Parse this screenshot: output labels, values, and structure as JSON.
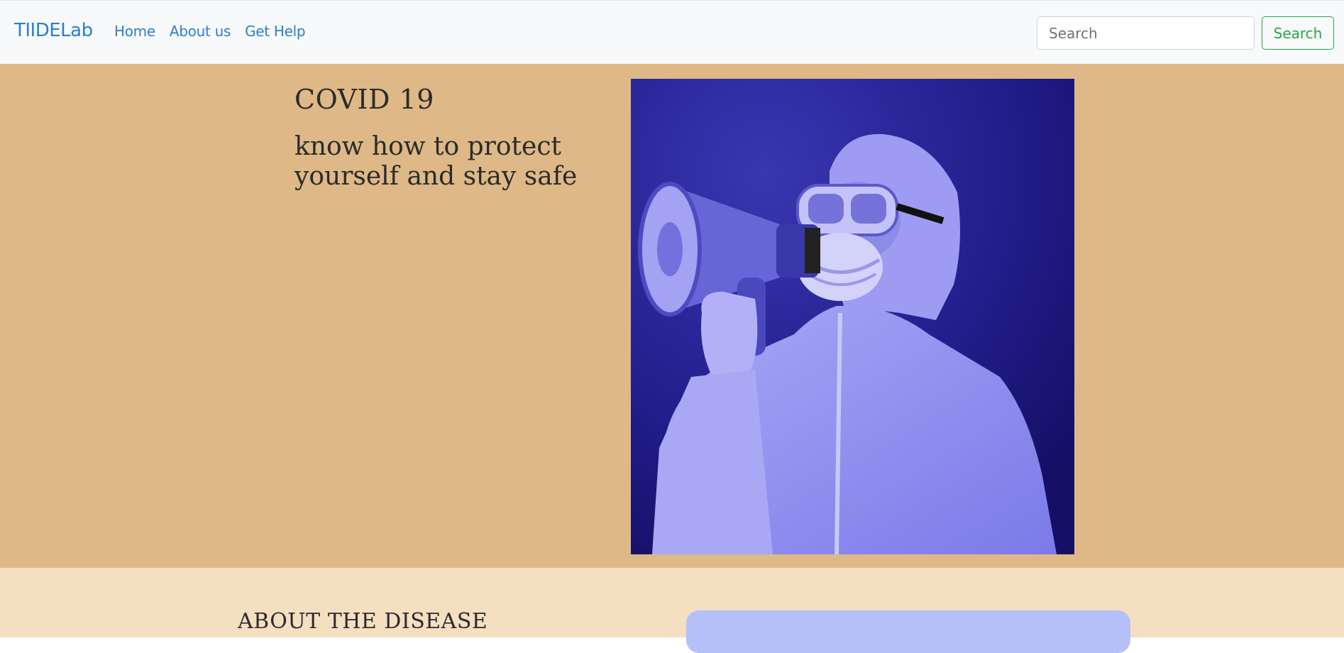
{
  "navbar": {
    "brand": "TIIDELab",
    "links": [
      "Home",
      "About us",
      "Get Help"
    ],
    "search": {
      "placeholder": "Search",
      "value": "",
      "button_label": "Search"
    }
  },
  "hero": {
    "title": "COVID 19",
    "subtitle": "know how to protect yourself and stay safe",
    "image_icon": "person-with-megaphone-image"
  },
  "about": {
    "title": "ABOUT THE DISEASE"
  },
  "colors": {
    "nav_bg": "#f8f9fa",
    "link": "#2a7fd0",
    "search_button": "#28a745",
    "hero_bg": "#deb887",
    "about_bg": "#f5dfc1",
    "image_bg": "#2a2596",
    "card_bg": "#b4c0f7"
  }
}
